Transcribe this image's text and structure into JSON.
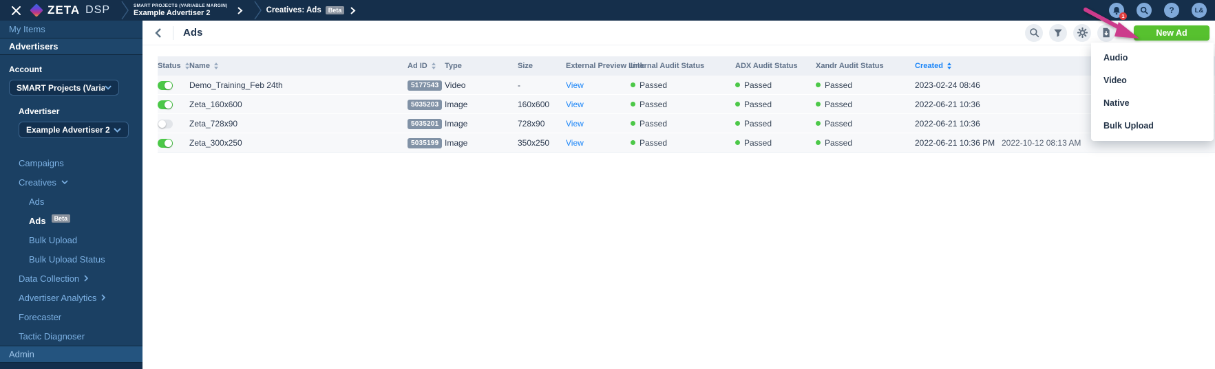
{
  "topbar": {
    "logo": {
      "brand": "ZETA",
      "product": "DSP"
    },
    "breadcrumbs": [
      {
        "eyebrow": "SMART PROJECTS (VARIABLE MARGIN)",
        "label": "Example Advertiser 2"
      },
      {
        "label": "Creatives: Ads",
        "badge": "Beta"
      }
    ],
    "actions": {
      "notification_count": "1",
      "help_label": "?",
      "avatar_label": "L&"
    }
  },
  "sidebar": {
    "my_items_label": "My Items",
    "advertisers_label": "Advertisers",
    "account": {
      "label": "Account",
      "value": "SMART Projects (Varia..."
    },
    "advertiser": {
      "label": "Advertiser",
      "value": "Example Advertiser 2"
    },
    "nav": [
      {
        "label": "Campaigns"
      },
      {
        "label": "Creatives"
      },
      {
        "label": "Ads"
      },
      {
        "label": "Ads",
        "badge": "Beta"
      },
      {
        "label": "Bulk Upload"
      },
      {
        "label": "Bulk Upload Status"
      },
      {
        "label": "Data Collection"
      },
      {
        "label": "Advertiser Analytics"
      },
      {
        "label": "Forecaster"
      },
      {
        "label": "Tactic Diagnoser"
      }
    ],
    "admin_label": "Admin"
  },
  "main": {
    "title": "Ads",
    "new_ad_button": "New Ad",
    "new_ad_menu": [
      "Audio",
      "Video",
      "Native",
      "Bulk Upload"
    ],
    "table": {
      "columns": [
        "Status",
        "Name",
        "Ad ID",
        "Type",
        "Size",
        "External Preview Link",
        "Internal Audit Status",
        "ADX Audit Status",
        "Xandr Audit Status",
        "Created"
      ],
      "sorted_column": "Created",
      "rows": [
        {
          "status_on": true,
          "name": "Demo_Training_Feb 24th",
          "ad_id": "5177543",
          "type": "Video",
          "size": "-",
          "preview": "View",
          "internal_audit": "Passed",
          "adx_audit": "Passed",
          "xandr_audit": "Passed",
          "created": "2023-02-24 08:46"
        },
        {
          "status_on": true,
          "name": "Zeta_160x600",
          "ad_id": "5035203",
          "type": "Image",
          "size": "160x600",
          "preview": "View",
          "internal_audit": "Passed",
          "adx_audit": "Passed",
          "xandr_audit": "Passed",
          "created": "2022-06-21 10:36"
        },
        {
          "status_on": false,
          "name": "Zeta_728x90",
          "ad_id": "5035201",
          "type": "Image",
          "size": "728x90",
          "preview": "View",
          "internal_audit": "Passed",
          "adx_audit": "Passed",
          "xandr_audit": "Passed",
          "created": "2022-06-21 10:36"
        },
        {
          "status_on": true,
          "name": "Zeta_300x250",
          "ad_id": "5035199",
          "type": "Image",
          "size": "350x250",
          "preview": "View",
          "internal_audit": "Passed",
          "adx_audit": "Passed",
          "xandr_audit": "Passed",
          "created": "2022-06-21 10:36 PM",
          "updated": "2022-10-12 08:13 AM"
        }
      ]
    }
  },
  "colors": {
    "topbar": "#152f4b",
    "sidebar": "#1b4063",
    "accent_green": "#57c12f",
    "toggle_on_green": "#4cc848",
    "status_pass_green": "#4cc848",
    "link_blue": "#1a85f8",
    "sorted_header_blue": "#1a85f8",
    "adid_badge_gray": "#8192a6",
    "beta_badge_gray": "#8a939f",
    "annotation_pink": "#cc3b8c"
  }
}
